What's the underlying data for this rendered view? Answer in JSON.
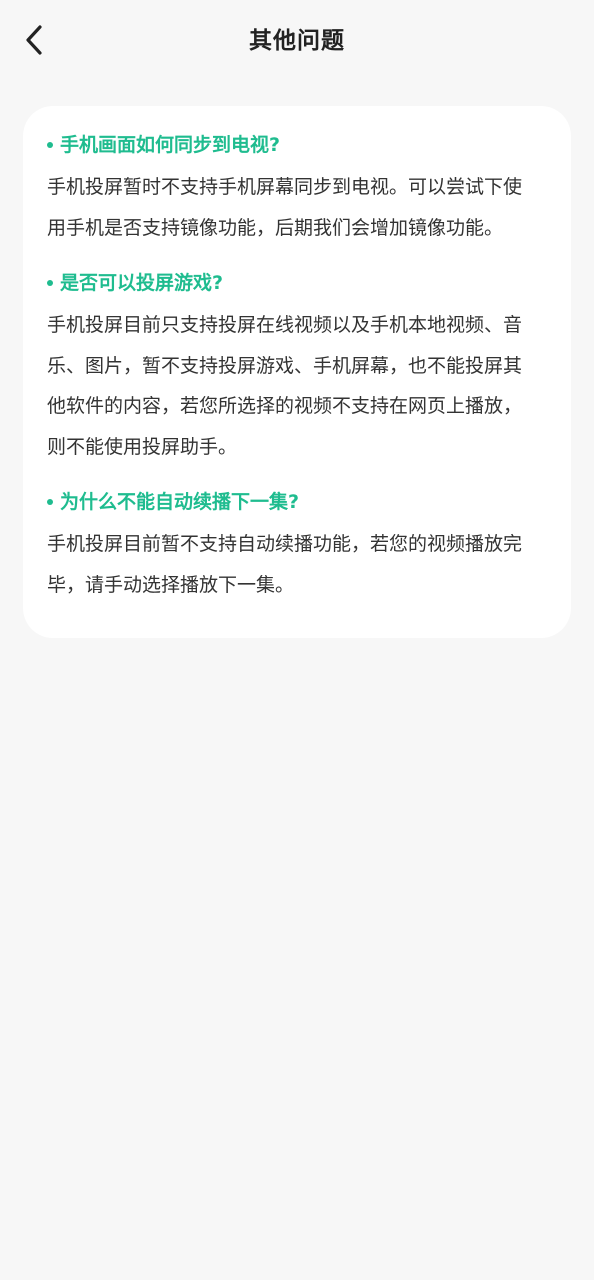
{
  "header": {
    "title": "其他问题",
    "back_icon": "chevron-left-icon"
  },
  "colors": {
    "accent": "#1fbc8f",
    "background": "#f7f7f7",
    "card": "#ffffff",
    "text": "#333333"
  },
  "faq": [
    {
      "question": "手机画面如何同步到电视?",
      "answer_lines": [
        "手机投屏暂时不支持手机屏幕同步到电视。可以尝试下使",
        "用手机是否支持镜像功能，后期我们会增加镜像功能。"
      ]
    },
    {
      "question": "是否可以投屏游戏?",
      "answer_lines": [
        "手机投屏目前只支持投屏在线视频以及手机本地视频、音",
        "乐、图片，暂不支持投屏游戏、手机屏幕，也不能投屏其",
        "他软件的内容，若您所选择的视频不支持在网页上播放，",
        "则不能使用投屏助手。"
      ]
    },
    {
      "question": "为什么不能自动续播下一集?",
      "answer_lines": [
        "手机投屏目前暂不支持自动续播功能，若您的视频播放完",
        "毕，请手动选择播放下一集。"
      ]
    }
  ]
}
